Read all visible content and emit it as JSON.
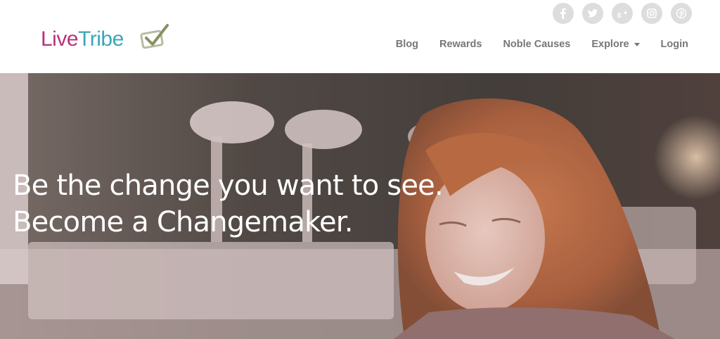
{
  "brand": {
    "logo_part1": "Live",
    "logo_part2": "Tribe",
    "logo_icon": "checkmark-box-icon",
    "colors": {
      "live": "#b8337a",
      "tribe": "#3ba6b8",
      "check": "#8a8f60"
    }
  },
  "social": [
    {
      "name": "facebook-icon",
      "glyph": "f"
    },
    {
      "name": "twitter-icon",
      "glyph": "bird"
    },
    {
      "name": "google-plus-icon",
      "glyph": "g+"
    },
    {
      "name": "instagram-icon",
      "glyph": "camera"
    },
    {
      "name": "pinterest-icon",
      "glyph": "p"
    }
  ],
  "nav": {
    "items": [
      {
        "label": "Blog"
      },
      {
        "label": "Rewards"
      },
      {
        "label": "Noble Causes"
      },
      {
        "label": "Explore",
        "dropdown": true
      },
      {
        "label": "Login"
      }
    ]
  },
  "hero": {
    "line1": "Be the change you want to see.",
    "line2": "Become a Changemaker."
  }
}
